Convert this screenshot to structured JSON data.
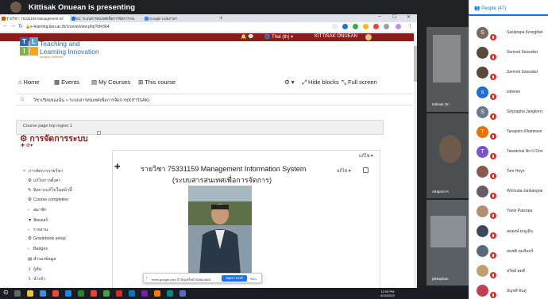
{
  "presenting": {
    "text": "Kittisak Onuean is presenting"
  },
  "browser": {
    "tabs": [
      {
        "label": "รายวิชา: 75331159 Management Inf"
      },
      {
        "label": "62: ระบบสารสนเทศเพื่อการจัดการ Kit"
      },
      {
        "label": "Google แปลภาษา"
      }
    ],
    "new_tab": "+",
    "url": "e-learning.buu.ac.th/course/view.php?id=364"
  },
  "moodle": {
    "language": "Thai (th)",
    "user": "KITTISAK ONUEAN",
    "logo": {
      "line1": "Teaching and",
      "line2": "Learning Innovation",
      "line3": "Burapha University",
      "t": "T",
      "l": "L",
      "i": "I"
    },
    "nav": {
      "home": "Home",
      "events": "Events",
      "my_courses": "My Courses",
      "this_course": "This course",
      "hide_blocks": "Hide blocks",
      "full_screen": "Full screen"
    },
    "breadcrumb": "วิชาเรียนของฉัน  >  ระบบสารสนเทศเพื่อการจัดการ(KITTISAK)",
    "region_top": "Course page top region 1",
    "admin": {
      "title": "การจัดการระบบ",
      "items": [
        {
          "icon": "˅",
          "label": "การจัดการรายวิชา"
        },
        {
          "icon": "⚙",
          "label": "แก้ไขการตั้งค่า"
        },
        {
          "icon": "✎",
          "label": "ปิดการแก้ไขในหน้านี้"
        },
        {
          "icon": "⚙",
          "label": "Course completion"
        },
        {
          "icon": "›",
          "label": "สมาชิก"
        },
        {
          "icon": "▼",
          "label": "ฟิลเตอร์"
        },
        {
          "icon": "›",
          "label": "รายงาน"
        },
        {
          "icon": "⚙",
          "label": "Gradebook setup"
        },
        {
          "icon": "›",
          "label": "Badges"
        },
        {
          "icon": "▤",
          "label": "สำรองข้อมูล"
        },
        {
          "icon": "⇪",
          "label": "กู้คืน"
        },
        {
          "icon": "⇪",
          "label": "นำเข้า"
        }
      ]
    },
    "course": {
      "line1": "รายวิชา 75331159 Management Information System",
      "line2": "(ระบบสารสนเทศเพื่อการจัดการ)",
      "edit_top": "แก้ไข ▾",
      "edit_inner": "แก้ไข ▾"
    }
  },
  "share_banner": {
    "text": "meet.google.com กำลังแชร์หน้าจอของคุณ",
    "stop": "หยุดการแชร์",
    "hide": "ซ่อน"
  },
  "tiles": [
    {
      "name": "Kittisak On"
    },
    {
      "name": "Attaporn K"
    },
    {
      "name": "jakkaphan"
    }
  ],
  "taskbar": {
    "time": "12:05 PM",
    "date": "4/24/2020"
  },
  "people": {
    "header": "People (47)",
    "list": [
      {
        "name": "Sasiprapa Krongdan",
        "initial": "S",
        "color": "#7a6a5a"
      },
      {
        "name": "Sermsit Soisodori",
        "initial": "",
        "color": "#5a4a3a"
      },
      {
        "name": "Sermsit Soisodori",
        "initial": "",
        "color": "#5a4a3a"
      },
      {
        "name": "siriwree",
        "initial": "s",
        "color": "#1e6fd1"
      },
      {
        "name": "Siriprapha Jangkorn",
        "initial": "S",
        "color": "#6a7a8a"
      },
      {
        "name": "Tanaporn Khamwan",
        "initial": "T",
        "color": "#e8710a"
      },
      {
        "name": "Tawatchai No U Don",
        "initial": "T",
        "color": "#7b55c7"
      },
      {
        "name": "Tom Heyn",
        "initial": "",
        "color": "#8a5a4a"
      },
      {
        "name": "Wichuda Jankangrai",
        "initial": "",
        "color": "#6a5a6a"
      },
      {
        "name": "Yanin Patsopa",
        "initial": "",
        "color": "#b09070"
      },
      {
        "name": "สมพงษ์ มณูเดิม",
        "initial": "",
        "color": "#3a4a5a"
      },
      {
        "name": "สมชติ ทุมสันทร์",
        "initial": "",
        "color": "#5a6a7a"
      },
      {
        "name": "สุวิทย์ สุดดี",
        "initial": "",
        "color": "#c0a070"
      },
      {
        "name": "อัญชลี จินดู",
        "initial": "",
        "color": "#c04050"
      }
    ]
  }
}
